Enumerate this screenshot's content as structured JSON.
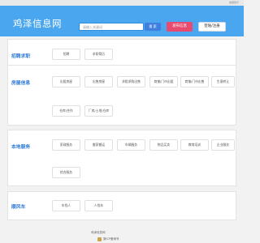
{
  "topbar": {
    "favorite": "收藏我们"
  },
  "header": {
    "logo": "鸡泽信息网",
    "search_placeholder": "请输入关键词",
    "search_label": "搜 索",
    "post_label": "发布信息",
    "login_label": "登陆/注册"
  },
  "sections": [
    {
      "title": "招聘求职",
      "items": [
        "招聘",
        "求职简历"
      ]
    },
    {
      "title": "房屋信息",
      "items": [
        "出租房屋",
        "出售房屋",
        "求租求购出售",
        "商铺/门市出租",
        "商铺/门市出售",
        "生意转让",
        "仓库/合作",
        "厂房/土地/仓库"
      ]
    },
    {
      "title": "本地服务",
      "items": [
        "家政服务",
        "搬家搬运",
        "车辆服务",
        "物品买卖",
        "教育培训",
        "企业服务",
        "综合服务"
      ]
    },
    {
      "title": "顺风车",
      "items": [
        "车找人",
        "人找车"
      ]
    }
  ],
  "footer": {
    "line1": "鸡泽信息网",
    "line2": "冀ICP备案号"
  }
}
